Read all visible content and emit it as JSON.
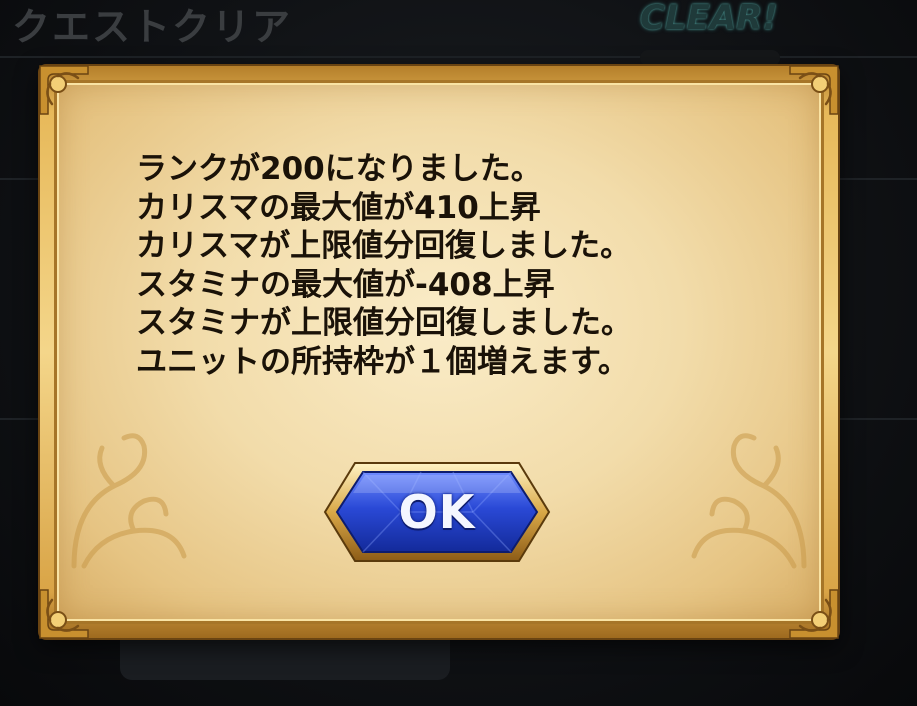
{
  "background": {
    "screen_title": "クエストクリア",
    "clear_badge": "CLEAR!"
  },
  "dialog": {
    "messages": [
      "ランクが200になりました。",
      "カリスマの最大値が410上昇",
      "カリスマが上限値分回復しました。",
      "スタミナの最大値が-408上昇",
      "スタミナが上限値分回復しました。",
      "ユニットの所持枠が１個増えます。"
    ],
    "ok_label": "OK"
  },
  "colors": {
    "parchment": "#f2dcaa",
    "frame_gold": "#e7b95a",
    "button_blue": "#2a49d6",
    "text": "#1a1208"
  },
  "icons": [
    "gold-corner-ornament-icon",
    "scroll-flourish-icon"
  ]
}
